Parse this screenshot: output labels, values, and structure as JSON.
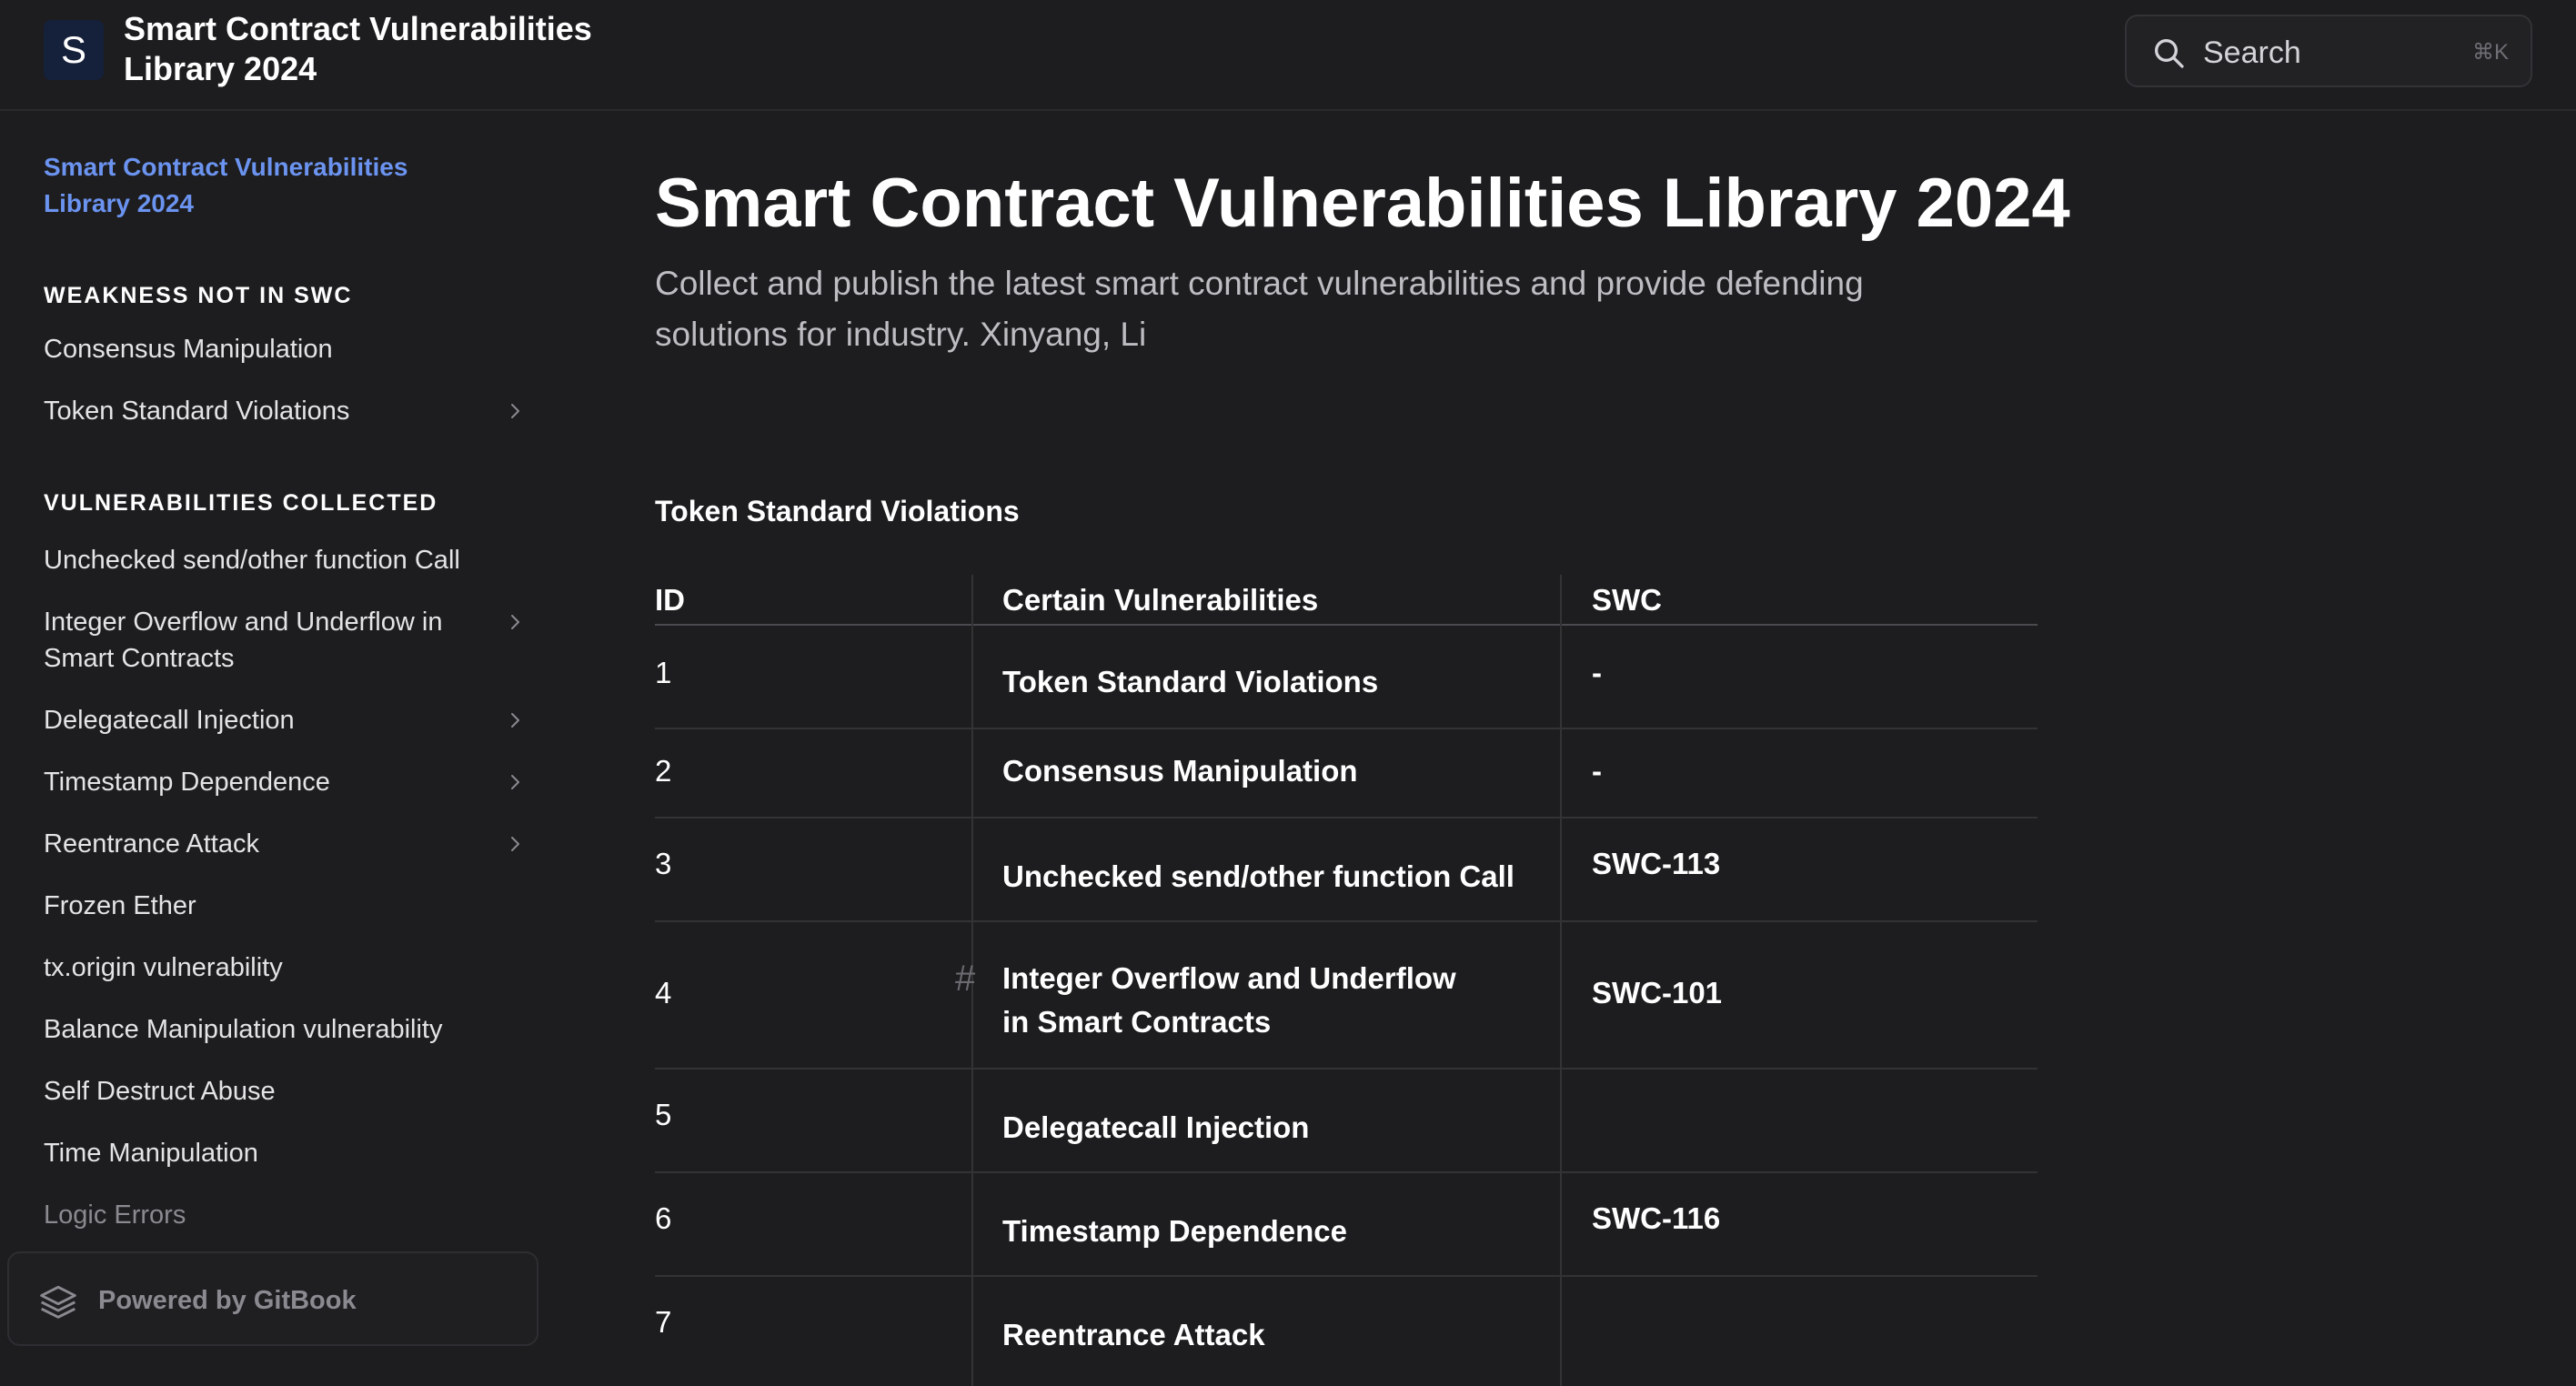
{
  "header": {
    "logo_letter": "S",
    "site_title": "Smart Contract Vulnerabilities Library 2024",
    "search_label": "Search",
    "search_shortcut": "⌘K"
  },
  "sidebar": {
    "home_link": "Smart Contract Vulnerabilities Library 2024",
    "sections": [
      {
        "title": "WEAKNESS NOT IN SWC",
        "items": [
          {
            "label": "Consensus Manipulation",
            "expandable": false
          },
          {
            "label": "Token Standard Violations",
            "expandable": true
          }
        ]
      },
      {
        "title": "VULNERABILITIES COLLECTED",
        "items": [
          {
            "label": "Unchecked send/other function Call",
            "expandable": false
          },
          {
            "label": "Integer Overflow and Underflow in Smart Contracts",
            "expandable": true
          },
          {
            "label": "Delegatecall Injection",
            "expandable": true
          },
          {
            "label": "Timestamp Dependence",
            "expandable": true
          },
          {
            "label": "Reentrance Attack",
            "expandable": true
          },
          {
            "label": "Frozen Ether",
            "expandable": false
          },
          {
            "label": "tx.origin vulnerability",
            "expandable": false
          },
          {
            "label": "Balance Manipulation vulnerability",
            "expandable": false
          },
          {
            "label": "Self Destruct Abuse",
            "expandable": false
          },
          {
            "label": "Time Manipulation",
            "expandable": false
          },
          {
            "label": "Logic Errors",
            "expandable": false
          }
        ]
      }
    ],
    "footer": "Powered by GitBook"
  },
  "main": {
    "title": "Smart Contract Vulnerabilities Library 2024",
    "description": "Collect and publish the latest smart contract vulnerabilities and provide defending solutions for industry. Xinyang, Li",
    "table_heading": "Token Standard Violations",
    "table": {
      "columns": [
        "ID",
        "Certain Vulnerabilities",
        "SWC"
      ],
      "rows": [
        {
          "id": "1",
          "vulnerability": "Token Standard Violations",
          "swc": "-"
        },
        {
          "id": "2",
          "vulnerability": "Consensus Manipulation",
          "swc": "-"
        },
        {
          "id": "3",
          "vulnerability": "Unchecked send/other function Call",
          "swc": "SWC-113"
        },
        {
          "id": "4",
          "vulnerability": "Integer Overflow and Underflow in Smart Contracts",
          "swc": "SWC-101"
        },
        {
          "id": "5",
          "vulnerability": "Delegatecall Injection",
          "swc": ""
        },
        {
          "id": "6",
          "vulnerability": "Timestamp Dependence",
          "swc": "SWC-116"
        },
        {
          "id": "7",
          "vulnerability": "Reentrance Attack",
          "swc": ""
        }
      ]
    }
  },
  "colors": {
    "background": "#1d1d1f",
    "link_accent": "#6b93f0",
    "logo_bg": "#15203a"
  }
}
